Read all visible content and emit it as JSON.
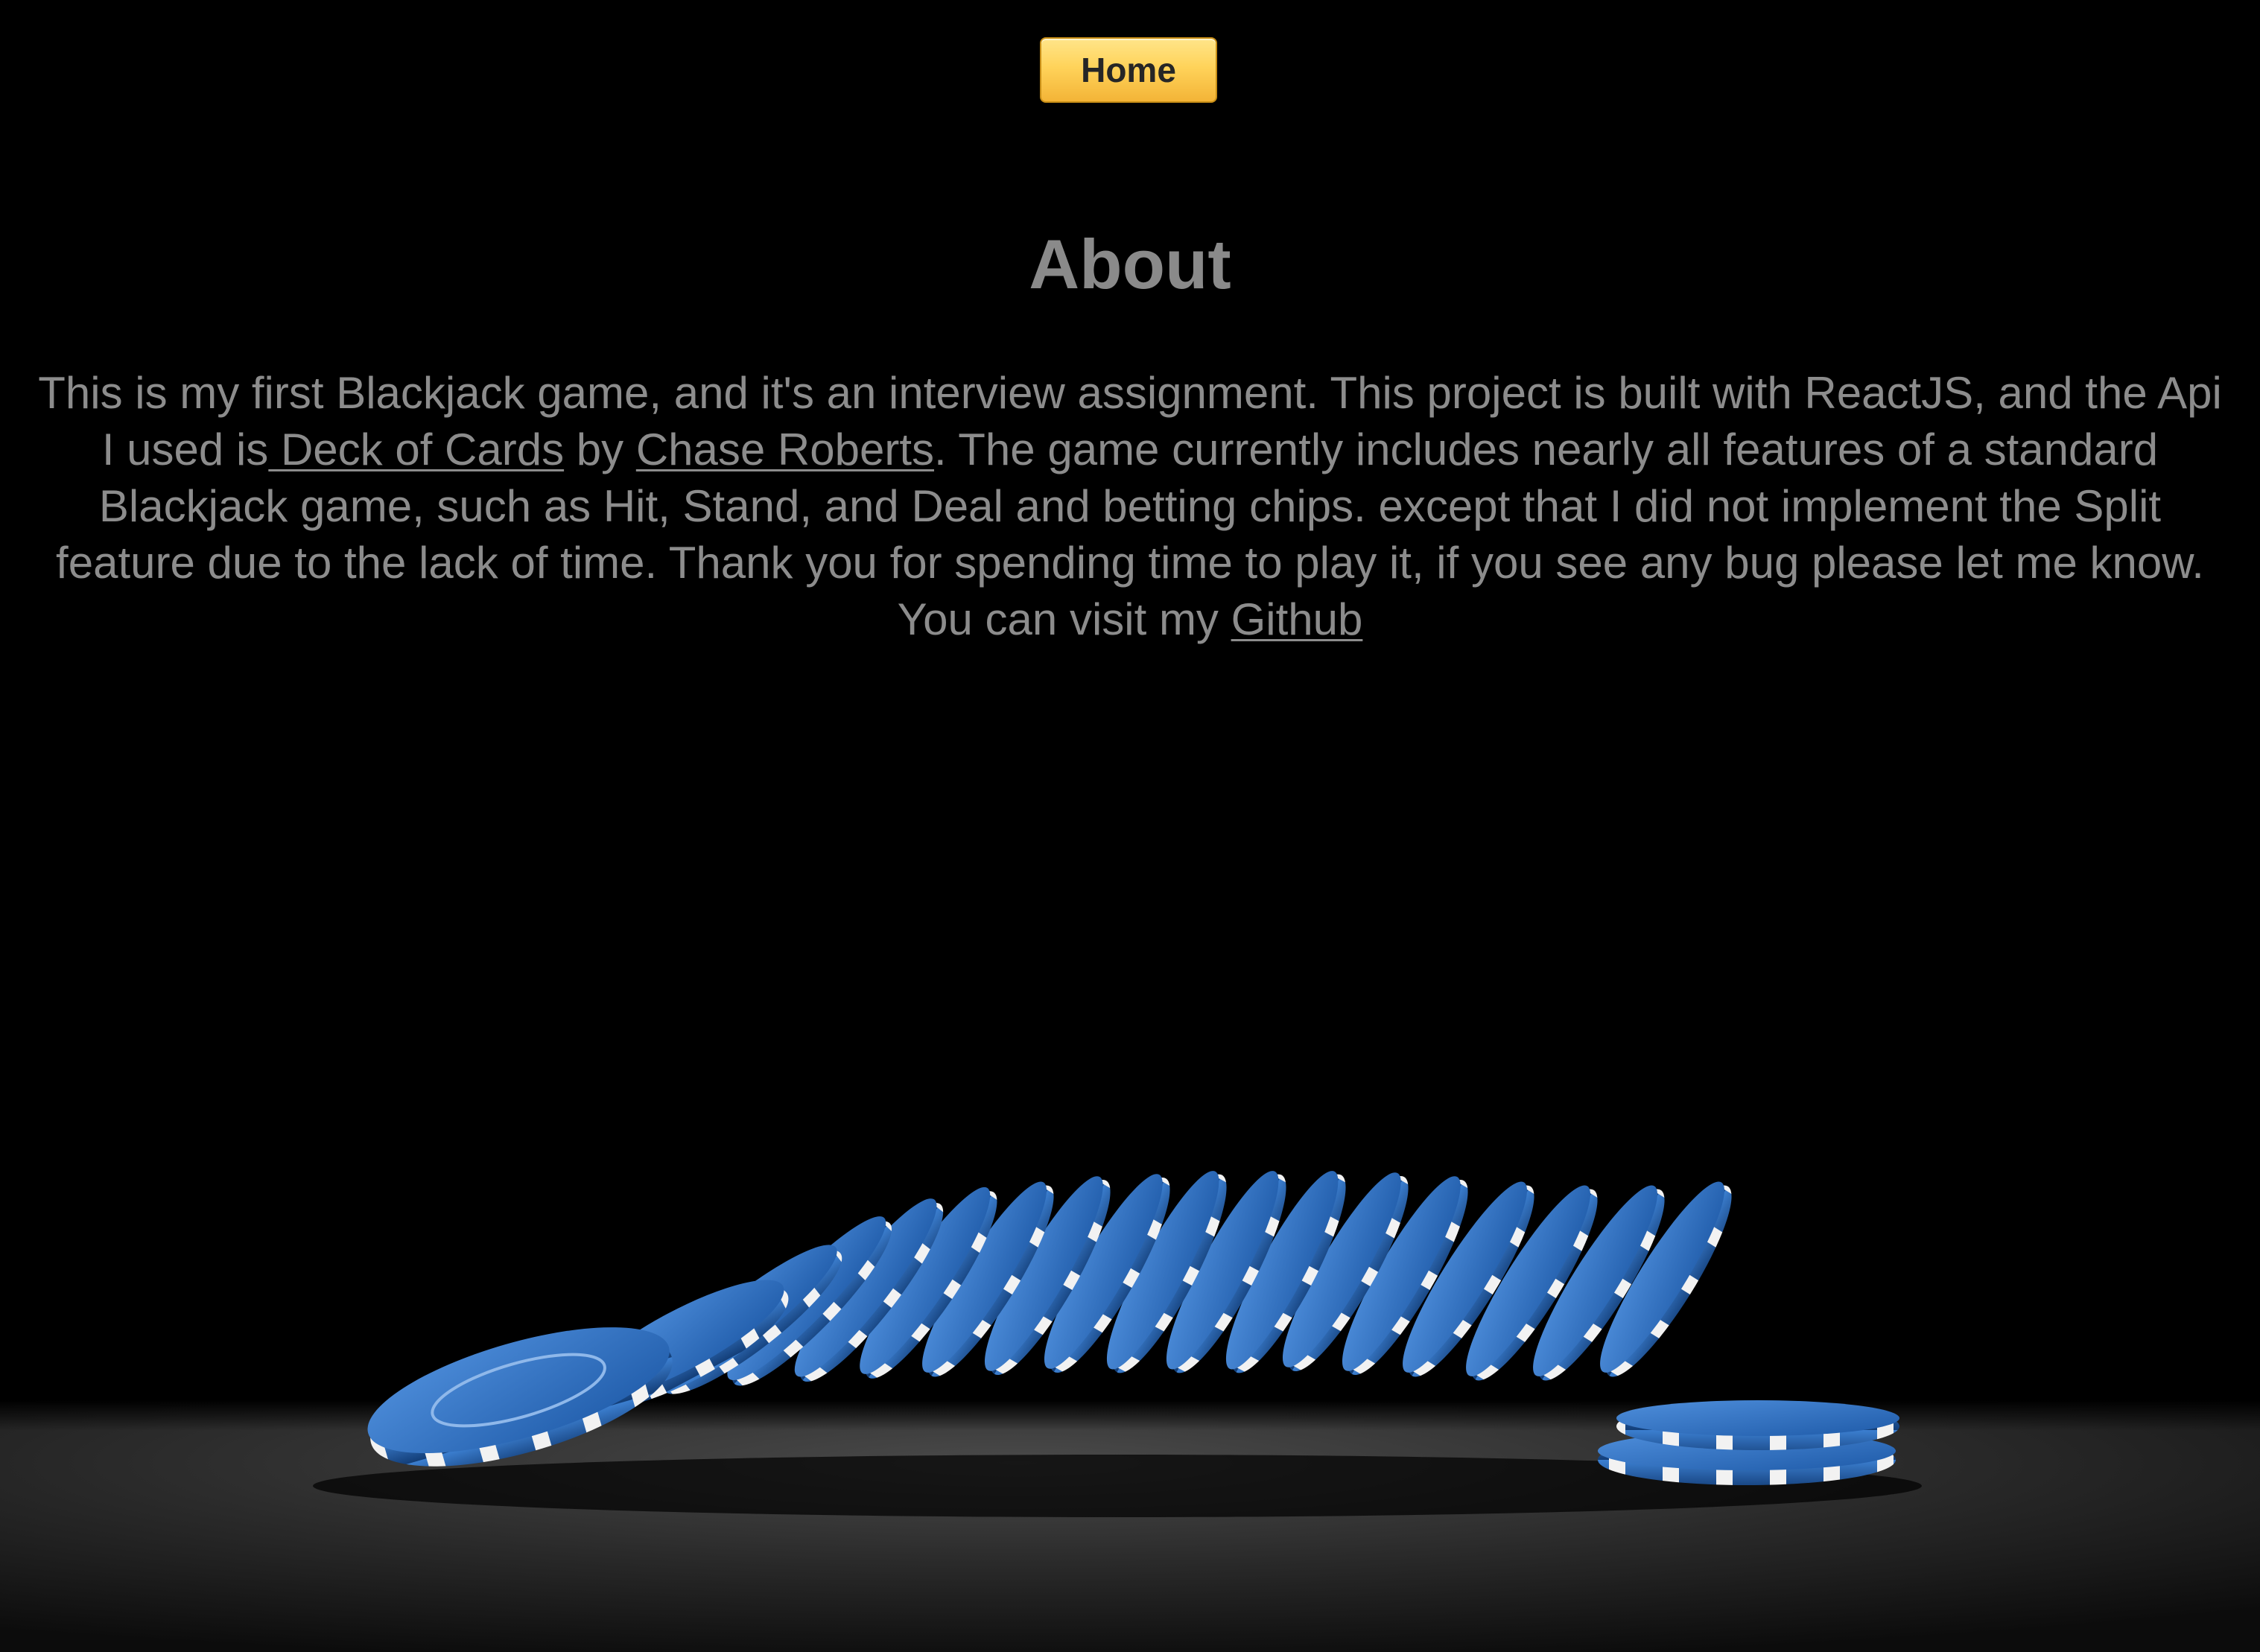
{
  "nav": {
    "home_label": "Home"
  },
  "about": {
    "title": "About",
    "text_1": "This is my first Blackjack game, and it's an interview assignment. This project is built with ReactJS, and the Api I used is",
    "link_deck": " Deck of Cards",
    "text_2": " by ",
    "link_author": "Chase Roberts",
    "text_3": ". The game currently includes nearly all features of a standard Blackjack game, such as Hit, Stand, and Deal and betting chips. except that I did not implement the Split feature due to the lack of time. Thank you for spending time to play it, if you see any bug please let me know. You can visit my ",
    "link_github": "Github"
  },
  "colors": {
    "background": "#000000",
    "text": "#8c8c8c",
    "button": "#ffd35a",
    "chip_blue": "#2f74c6",
    "chip_white": "#ffffff",
    "table": "#2b2b2b"
  },
  "background_image": "stack of blue and white poker chips falling on a dark table"
}
